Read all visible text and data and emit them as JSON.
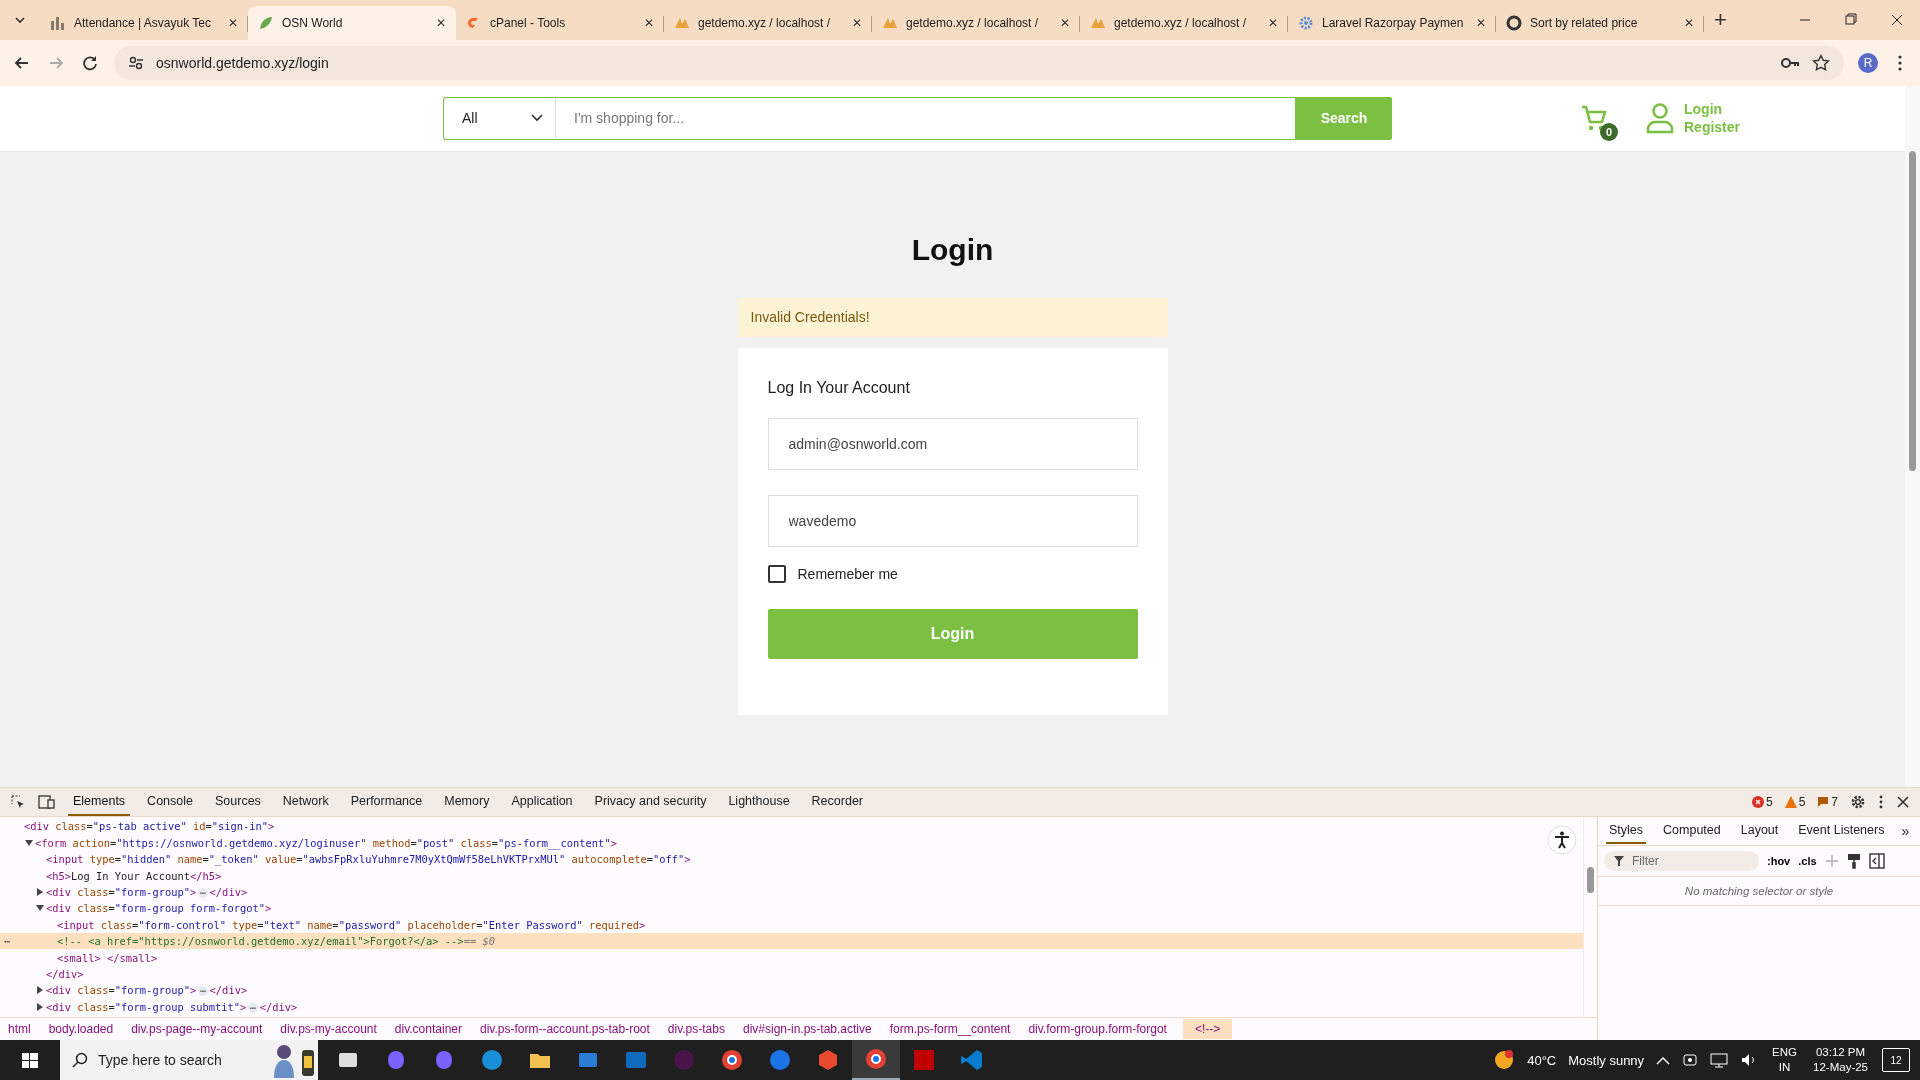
{
  "browser": {
    "tabs": [
      {
        "title": "Attendance | Asvayuk Tec",
        "kind": "chart",
        "selected": false
      },
      {
        "title": "OSN World",
        "kind": "leaf",
        "selected": true
      },
      {
        "title": "cPanel - Tools",
        "kind": "cpanel",
        "selected": false
      },
      {
        "title": "getdemo.xyz / localhost /",
        "kind": "pma",
        "selected": false
      },
      {
        "title": "getdemo.xyz / localhost /",
        "kind": "pma",
        "selected": false
      },
      {
        "title": "getdemo.xyz / localhost /",
        "kind": "pma",
        "selected": false
      },
      {
        "title": "Laravel Razorpay Paymen",
        "kind": "gear",
        "selected": false
      },
      {
        "title": "Sort by related price",
        "kind": "ring",
        "selected": false
      }
    ],
    "close_glyph": "✕",
    "new_tab": "+",
    "address": "osnworld.getdemo.xyz/login",
    "profile": "R"
  },
  "site": {
    "category": "All",
    "search_placeholder": "I'm shopping for...",
    "search_button": "Search",
    "cart_count": "0",
    "login_link": "Login",
    "register_link": "Register"
  },
  "login": {
    "title": "Login",
    "alert": "Invalid Credentials!",
    "card_title": "Log In Your Account",
    "email": "admin@osnworld.com",
    "password": "wavedemo",
    "remember": {
      "label": "Rememeber me",
      "checked": false
    },
    "button": "Login"
  },
  "devtools": {
    "tabs": [
      {
        "label": "Elements",
        "selected": true
      },
      {
        "label": "Console",
        "selected": false
      },
      {
        "label": "Sources",
        "selected": false
      },
      {
        "label": "Network",
        "selected": false
      },
      {
        "label": "Performance",
        "selected": false
      },
      {
        "label": "Memory",
        "selected": false
      },
      {
        "label": "Application",
        "selected": false
      },
      {
        "label": "Privacy and security",
        "selected": false
      },
      {
        "label": "Lighthouse",
        "selected": false
      },
      {
        "label": "Recorder",
        "selected": false
      }
    ],
    "errors": "5",
    "warnings": "5",
    "messages": "7",
    "dom": [
      {
        "text": "<div class=\"ps-tab active\" id=\"sign-in\">",
        "selected": false,
        "children": [
          {
            "text": "<form action=\"https://osnworld.getdemo.xyz/loginuser\" method=\"post\" class=\"ps-form__content\">",
            "expanded": true,
            "selected": false,
            "children": [
              {
                "text": "<input type=\"hidden\" name=\"_token\" value=\"awbsFpRxluYuhmre7M0yXtQmWf58eLhVKTPrxMUl\" autocomplete=\"off\">",
                "selected": false
              },
              {
                "text": "<h5>Log In Your Account</h5>",
                "selected": false
              },
              {
                "text": "<div class=\"form-group\">",
                "expanded": false,
                "ellipsis": "⋯",
                "close": "</div>",
                "selected": false
              },
              {
                "text": "<div class=\"form-group form-forgot\">",
                "expanded": true,
                "close": "</div>",
                "selected": false,
                "children": [
                  {
                    "text": "<input class=\"form-control\" type=\"text\" name=\"password\" placeholder=\"Enter Password\" required>",
                    "selected": false
                  },
                  {
                    "text": "<!-- <a href=\"https://osnworld.getdemo.xyz/email\">Forgot?</a> -->",
                    "suffix": "== $0",
                    "more": "⋯",
                    "selected": true
                  },
                  {
                    "text": "<small> </small>",
                    "selected": false
                  }
                ]
              },
              {
                "text": "<div class=\"form-group\">",
                "expanded": false,
                "ellipsis": "⋯",
                "close": "</div>",
                "selected": false
              },
              {
                "text": "<div class=\"form-group submtit\">",
                "expanded": false,
                "ellipsis": "⋯",
                "close": "</div>",
                "selected": false
              }
            ]
          }
        ]
      }
    ],
    "breadcrumbs": [
      {
        "label": "html",
        "selected": false
      },
      {
        "label": "body.loaded",
        "selected": false
      },
      {
        "label": "div.ps-page--my-account",
        "selected": false
      },
      {
        "label": "div.ps-my-account",
        "selected": false
      },
      {
        "label": "div.container",
        "selected": false
      },
      {
        "label": "div.ps-form--account.ps-tab-root",
        "selected": false
      },
      {
        "label": "div.ps-tabs",
        "selected": false
      },
      {
        "label": "div#sign-in.ps-tab.active",
        "selected": false
      },
      {
        "label": "form.ps-form__content",
        "selected": false
      },
      {
        "label": "div.form-group.form-forgot",
        "selected": false
      },
      {
        "label": "<!-->",
        "selected": true
      }
    ],
    "styles_tabs": [
      {
        "label": "Styles",
        "selected": true
      },
      {
        "label": "Computed",
        "selected": false
      },
      {
        "label": "Layout",
        "selected": false
      },
      {
        "label": "Event Listeners",
        "selected": false
      }
    ],
    "more_tabs": "»",
    "filter_placeholder": "Filter",
    "hov": ":hov",
    "cls": ".cls",
    "empty_note": "No matching selector or style"
  },
  "taskbar": {
    "search_placeholder": "Type here to search",
    "temperature": "40°C",
    "weather": "Mostly sunny",
    "language": "ENG",
    "region": "IN",
    "time": "03:12 PM",
    "date": "12-May-25",
    "notifications": "12"
  }
}
